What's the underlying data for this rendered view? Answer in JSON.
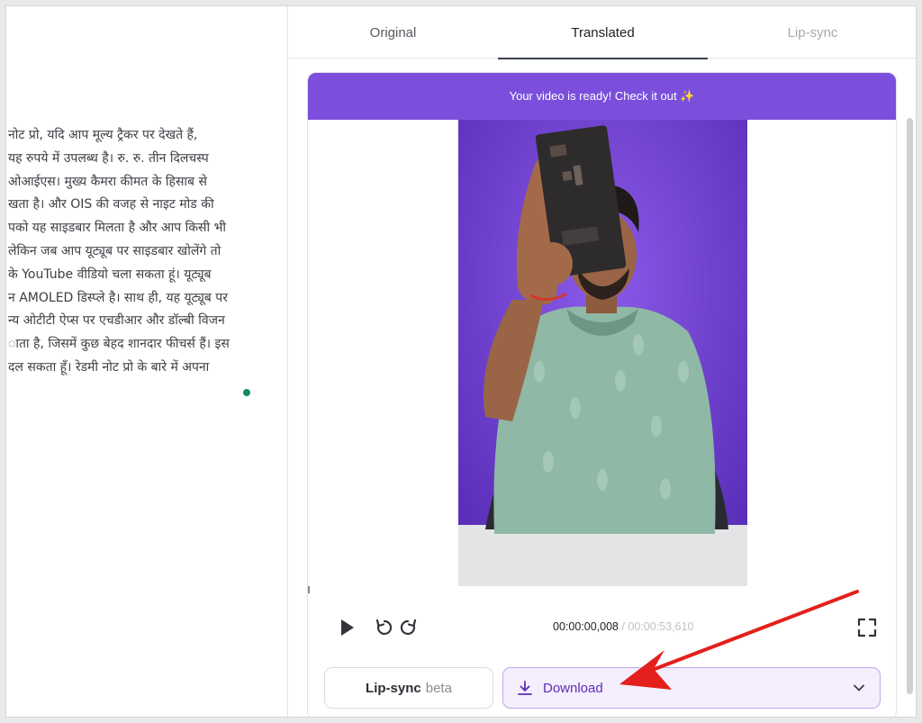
{
  "tabs": {
    "original": "Original",
    "translated": "Translated",
    "lipsync": "Lip-sync",
    "active": "Translated"
  },
  "transcript": {
    "lines": [
      "नोट प्रो, यदि आप मूल्य ट्रैकर पर देखते हैं,",
      "यह रुपये में उपलब्ध है। रु. रु. तीन दिलचस्प",
      "ओआईएस। मुख्य कैमरा कीमत के हिसाब से",
      "खता है। और OIS की वजह से नाइट मोड की",
      "पको यह साइडबार मिलता है और आप किसी भी",
      "लेकिन जब आप यूट्यूब पर साइडबार खोलेंगे तो",
      "के YouTube वीडियो चला सकता हूं। यूट्यूब",
      "न AMOLED डिस्प्ले है। साथ ही, यह यूट्यूब पर",
      "न्य ओटीटी ऐप्स पर एचडीआर और डॉल्बी विजन",
      "ाता है, जिसमें कुछ बेहद शानदार फीचर्स हैं। इस",
      "दल सकता हूँ। रेडमी नोट प्रो के बारे में अपना"
    ]
  },
  "video": {
    "banner": "Your video is ready! Check it out ✨",
    "current_time": "00:00:00,008",
    "separator": " / ",
    "total_time": "00:00:53,610"
  },
  "actions": {
    "lipsync_label": "Lip-sync",
    "lipsync_badge": "beta",
    "download_label": "Download"
  },
  "colors": {
    "accent": "#7b4fdc",
    "download_text": "#5b2fb5",
    "download_bg": "#f4eefd",
    "annotation_arrow": "#e3201b",
    "cursor_dot": "#138a6c"
  },
  "icons": {
    "play": "play-icon",
    "rewind": "rewind-icon",
    "forward": "forward-icon",
    "fullscreen": "fullscreen-icon",
    "download": "download-icon",
    "chevron": "chevron-down-icon"
  }
}
